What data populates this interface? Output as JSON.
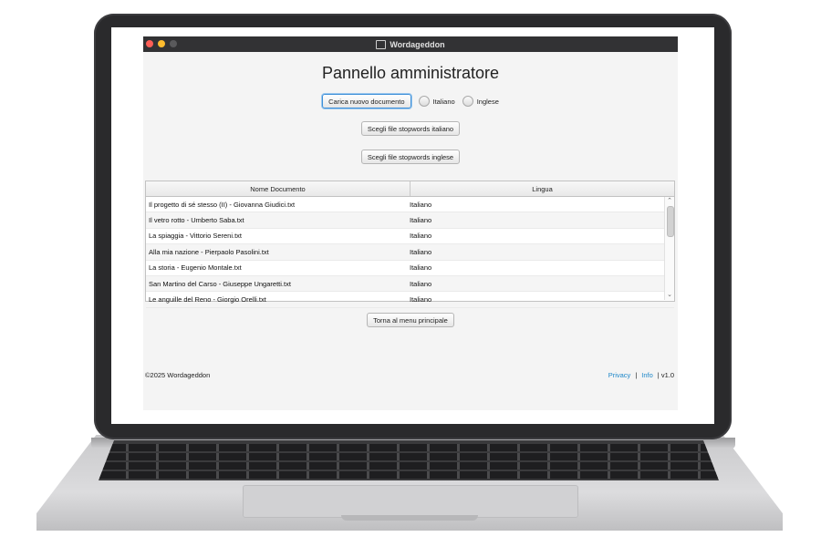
{
  "window": {
    "title": "Wordageddon"
  },
  "page": {
    "title": "Pannello amministratore"
  },
  "actions": {
    "upload_label": "Carica nuovo documento",
    "radio_italian": "Italiano",
    "radio_english": "Inglese",
    "stopwords_it_label": "Scegli file stopwords italiano",
    "stopwords_en_label": "Scegli file stopwords inglese",
    "back_label": "Torna al menu principale"
  },
  "table": {
    "headers": [
      "Nome Documento",
      "Lingua"
    ],
    "rows": [
      [
        "Il progetto di sé stesso (II) - Giovanna Giudici.txt",
        "Italiano"
      ],
      [
        "Il vetro rotto - Umberto Saba.txt",
        "Italiano"
      ],
      [
        "La spiaggia - Vittorio Sereni.txt",
        "Italiano"
      ],
      [
        "Alla mia nazione - Pierpaolo Pasolini.txt",
        "Italiano"
      ],
      [
        "La storia - Eugenio Montale.txt",
        "Italiano"
      ],
      [
        "San Martino del Carso - Giuseppe Ungaretti.txt",
        "Italiano"
      ],
      [
        "Le anguille del Reno - Giorgio Orelli.txt",
        "Italiano"
      ]
    ]
  },
  "footer": {
    "copyright": "©2025 Wordageddon",
    "privacy": "Privacy",
    "sep": "|",
    "info": "Info",
    "version": "| v1.0"
  },
  "colors": {
    "link": "#1e87c9",
    "titlebar": "#323234",
    "focus": "#3d8fd8"
  }
}
